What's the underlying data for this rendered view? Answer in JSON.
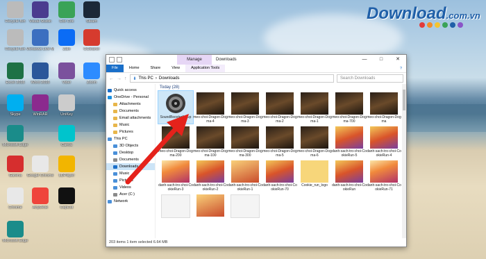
{
  "watermark": {
    "text": "Download",
    ".vn": "",
    "domain": ".com.vn"
  },
  "desktop_icons": [
    {
      "label": "Recycle Bin",
      "color": "#bbb"
    },
    {
      "label": "Visual Studio",
      "color": "#4a3b8f"
    },
    {
      "label": "Cốc Cốc",
      "color": "#3aa357"
    },
    {
      "label": "Steam",
      "color": "#1b2838"
    },
    {
      "label": "Recycle Bin",
      "color": "#bbb"
    },
    {
      "label": "Windows Live Mail",
      "color": "#3b6fc0"
    },
    {
      "label": "Zalo",
      "color": "#0b6cf5"
    },
    {
      "label": "CCleaner",
      "color": "#d63b2e"
    },
    {
      "label": "Excel 2016",
      "color": "#1e7145"
    },
    {
      "label": "Word 2016",
      "color": "#2b579a"
    },
    {
      "label": "Viber",
      "color": "#7b519d"
    },
    {
      "label": "Zoom",
      "color": "#2d8cff"
    },
    {
      "label": "Skype",
      "color": "#00aff0"
    },
    {
      "label": "WinRAR",
      "color": "#8b2a8e"
    },
    {
      "label": "UniKey",
      "color": "#ccc"
    },
    {
      "label": "Microsoft Edge",
      "color": "#1a8c8a"
    },
    {
      "label": "Canva",
      "color": "#00c4cc"
    },
    {
      "label": "Garena",
      "color": "#d62e2e"
    },
    {
      "label": "Google Chrome",
      "color": "#e8e8e8"
    },
    {
      "label": "LDPlayer",
      "color": "#f2b500"
    },
    {
      "label": "Chrome",
      "color": "#e8e8e8"
    },
    {
      "label": "AnyDesk",
      "color": "#ef443b"
    },
    {
      "label": "CapCut",
      "color": "#111"
    },
    {
      "label": "Microsoft Edge",
      "color": "#1a8c8a"
    }
  ],
  "explorer": {
    "title": "Downloads",
    "manage_tab": "Manage",
    "ribbon_tabs": [
      "File",
      "Home",
      "Share",
      "View",
      "Application Tools"
    ],
    "path": [
      "This PC",
      "Downloads"
    ],
    "search_placeholder": "Search Downloads",
    "group_header": "Today (28)",
    "nav_items": [
      {
        "label": "Quick access",
        "color": "#1a6fc9"
      },
      {
        "label": "OneDrive - Personal",
        "color": "#1a8fe0"
      },
      {
        "label": "Attachments",
        "color": "#e8b64a"
      },
      {
        "label": "Documents",
        "color": "#e8b64a"
      },
      {
        "label": "Email attachments",
        "color": "#e8b64a"
      },
      {
        "label": "Music",
        "color": "#e8b64a"
      },
      {
        "label": "Pictures",
        "color": "#e8b64a"
      },
      {
        "label": "This PC",
        "color": "#4a90d9"
      },
      {
        "label": "3D Objects",
        "color": "#4a90d9"
      },
      {
        "label": "Desktop",
        "color": "#4a90d9"
      },
      {
        "label": "Documents",
        "color": "#8a8a8a"
      },
      {
        "label": "Downloads",
        "color": "#1a6fc9"
      },
      {
        "label": "Music",
        "color": "#4a90d9"
      },
      {
        "label": "Pictures",
        "color": "#4a90d9"
      },
      {
        "label": "Videos",
        "color": "#4a90d9"
      },
      {
        "label": "Acer (C:)",
        "color": "#8a8a8a"
      },
      {
        "label": "Network",
        "color": "#4a90d9"
      }
    ],
    "files": [
      {
        "name": "SoundBoosterSetup",
        "kind": "spk"
      },
      {
        "name": "meo-choi-Dragon-Dogma-4",
        "kind": ""
      },
      {
        "name": "meo-choi-Dragon-Dogma-3",
        "kind": ""
      },
      {
        "name": "meo-choi-Dragon-Dogma-2",
        "kind": ""
      },
      {
        "name": "meo-choi-Dragon-Dogma-1",
        "kind": ""
      },
      {
        "name": "meo-choi-Dragon-Dogma-700",
        "kind": ""
      },
      {
        "name": "meo-choi-Dragon-Dogma",
        "kind": ""
      },
      {
        "name": "meo-choi-Dragon-Dogma-200",
        "kind": ""
      },
      {
        "name": "meo-choi-Dragon-Dogma-100",
        "kind": ""
      },
      {
        "name": "meo-choi-Dragon-Dogma-300",
        "kind": ""
      },
      {
        "name": "meo-choi-Dragon-Dogma-5",
        "kind": ""
      },
      {
        "name": "meo-choi-Dragon-Dogma-6",
        "kind": ""
      },
      {
        "name": "danh-sach-tro-choi-CookieRun-5",
        "kind": "cr"
      },
      {
        "name": "danh-sach-tro-choi-CookieRun-4",
        "kind": "cr"
      },
      {
        "name": "danh-sach-tro-choi-CookieRun-3",
        "kind": "cr2"
      },
      {
        "name": "danh-sach-tro-choi-CookieRun-2",
        "kind": "cr"
      },
      {
        "name": "danh-sach-tro-choi-CookieRun-1",
        "kind": "kb"
      },
      {
        "name": "danh-sach-tro-choi-CookieRun-70",
        "kind": "cr"
      },
      {
        "name": "Cookie_run_logo",
        "kind": "logo"
      },
      {
        "name": "danh-sach-tro-choi-CookieRun",
        "kind": "cr"
      },
      {
        "name": "danh-sach-tro-choi-CookieRun-71",
        "kind": "cr2"
      },
      {
        "name": "",
        "kind": "blank"
      },
      {
        "name": "",
        "kind": "kb"
      },
      {
        "name": "",
        "kind": "blank"
      }
    ],
    "status": "203 items     1 item selected  6.64 MB"
  }
}
